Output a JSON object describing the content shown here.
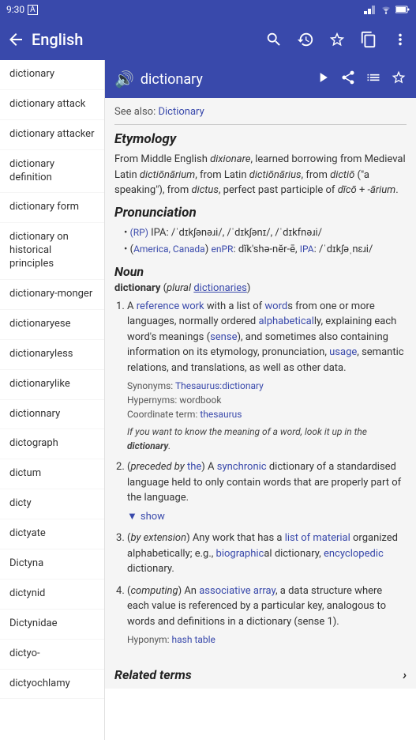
{
  "status_bar": {
    "time": "9:30",
    "sim": "A",
    "signal": "▲▼",
    "wifi": "wifi",
    "battery": "battery"
  },
  "app_bar": {
    "back_icon": "←",
    "title": "English",
    "search_icon": "search",
    "history_icon": "history",
    "star_icon": "star_outline",
    "copy_icon": "copy",
    "more_icon": "more_vert"
  },
  "sidebar": {
    "items": [
      {
        "id": "dictionary-1",
        "label": "dictionary"
      },
      {
        "id": "dictionary-attack",
        "label": "dictionary attack"
      },
      {
        "id": "dictionary-attacker",
        "label": "dictionary attacker"
      },
      {
        "id": "dictionary-definition",
        "label": "dictionary definition"
      },
      {
        "id": "dictionary-form",
        "label": "dictionary form"
      },
      {
        "id": "dictionary-on-historical",
        "label": "dictionary on historical principles"
      },
      {
        "id": "dictionary-monger",
        "label": "dictionary-monger"
      },
      {
        "id": "dictionaryese",
        "label": "dictionaryese"
      },
      {
        "id": "dictionaryless",
        "label": "dictionaryless"
      },
      {
        "id": "dictionarylike",
        "label": "dictionarylike"
      },
      {
        "id": "dictionnary",
        "label": "dictionnary"
      },
      {
        "id": "dictograph",
        "label": "dictograph"
      },
      {
        "id": "dictum",
        "label": "dictum"
      },
      {
        "id": "dicty",
        "label": "dicty"
      },
      {
        "id": "dictyate",
        "label": "dictyate"
      },
      {
        "id": "Dictyna",
        "label": "Dictyna"
      },
      {
        "id": "dictynid",
        "label": "dictynid"
      },
      {
        "id": "Dictynidae",
        "label": "Dictynidae"
      },
      {
        "id": "dictyo",
        "label": "dictyo-"
      },
      {
        "id": "dictyochlamy",
        "label": "dictyochlamy"
      }
    ]
  },
  "word_header": {
    "sound_icon": "🔊",
    "word": "dictionary",
    "play_icon": "▶",
    "share_icon": "share",
    "playlist_icon": "playlist",
    "star_icon": "star"
  },
  "article": {
    "see_also_label": "See also:",
    "see_also_link": "Dictionary",
    "etymology_title": "Etymology",
    "etymology_text": "From Middle English dixionare, learned borrowing from Medieval Latin dictiōnārium, from Latin dictiōnārius, from dictiō (\"a speaking\"), from dictus, perfect past participle of dīcō + -ārium.",
    "pronunciation_title": "Pronunciation",
    "pronunciations": [
      {
        "rp_label": "(RP)",
        "ipa_label": "IPA:",
        "ipa_value": "/ˈdɪkʃənəɹi/, /ˈdɪkʃənɪ/, /ˈdɪkfnəɹi/",
        "region": ""
      },
      {
        "region_label": "(America, Canada)",
        "enpr_label": "enPR:",
        "enpr_value": "dĭk'shə-nĕr-ē,",
        "ipa_label": "IPA:",
        "ipa_value": "/ˈdɪkʃəˌnɛɹi/"
      }
    ],
    "noun_title": "Noun",
    "noun_subheader": "dictionary (plural dictionaries)",
    "definitions": [
      {
        "number": 1,
        "text": "A reference work with a list of words from one or more languages, normally ordered alphabetically, explaining each word's meanings (sense), and sometimes also containing information on its etymology, pronunciation, usage, semantic relations, and translations, as well as other data.",
        "synonyms_label": "Synonyms:",
        "synonyms_link": "Thesaurus:dictionary",
        "hypernyms_label": "Hypernyms:",
        "hypernyms_value": "wordbook",
        "coord_label": "Coordinate term:",
        "coord_link": "thesaurus",
        "italic_note": "If you want to know the meaning of a word, look it up in the dictionary.",
        "italic_word": "dictionary"
      },
      {
        "number": 2,
        "preceded_label": "(preceded by",
        "preceded_link": "the",
        "text_after": ") A synchronic dictionary of a standardised language held to only contain words that are properly part of the language.",
        "show_label": "▼ show"
      },
      {
        "number": 3,
        "paren_label": "(by extension)",
        "text": "Any work that has a list of material organized alphabetically; e.g., biographical dictionary, encyclopedic dictionary.",
        "list_link": "list of material",
        "bio_link": "biographical",
        "enc_link": "encyclopedic"
      },
      {
        "number": 4,
        "paren_label": "(computing)",
        "text": "An associative array, a data structure where each value is referenced by a particular key, analogous to words and definitions in a dictionary (sense 1).",
        "assoc_link": "associative array",
        "hyponym_label": "Hyponym:",
        "hyponym_link": "hash table"
      }
    ],
    "related_terms_title": "Related terms",
    "related_terms_arrow": "›"
  }
}
